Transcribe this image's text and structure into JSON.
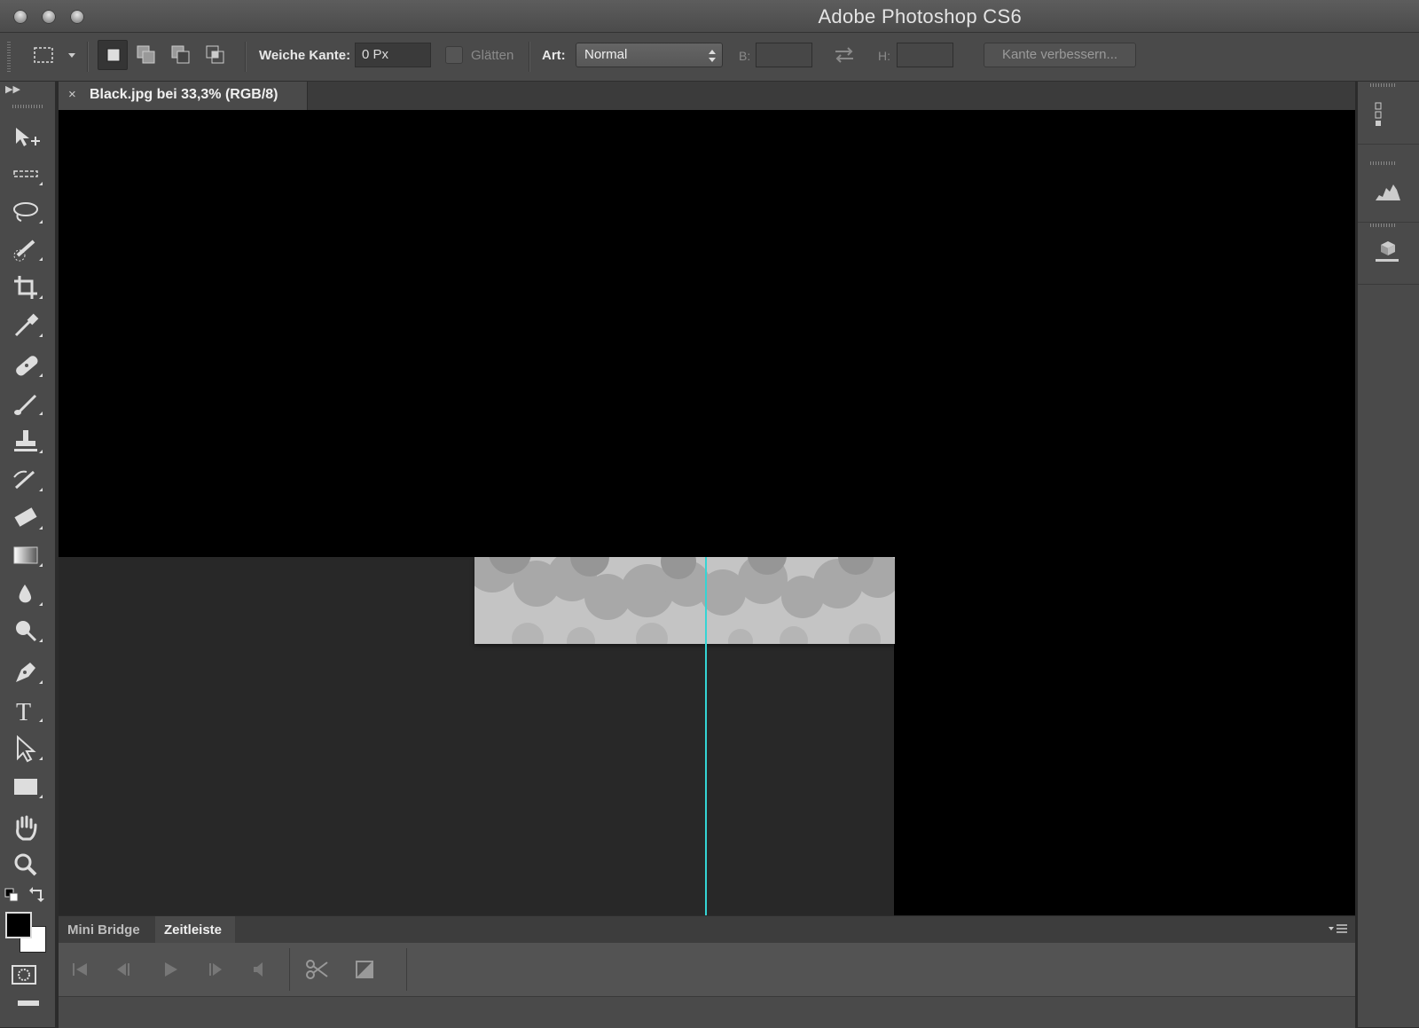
{
  "app": {
    "title": "Adobe Photoshop CS6"
  },
  "options_bar": {
    "feather_label": "Weiche Kante:",
    "feather_value": "0 Px",
    "antialias_label": "Glätten",
    "style_label": "Art:",
    "style_value": "Normal",
    "width_label": "B:",
    "height_label": "H:",
    "refine_edge_label": "Kante verbessern..."
  },
  "document": {
    "tab_title": "Black.jpg bei 33,3% (RGB/8)",
    "close_glyph": "×"
  },
  "timeline_panel": {
    "tabs": [
      {
        "label": "Mini Bridge",
        "active": false
      },
      {
        "label": "Zeitleiste",
        "active": true
      }
    ]
  },
  "tools": [
    "move-tool-icon",
    "marquee-tool-icon",
    "lasso-tool-icon",
    "quick-selection-tool-icon",
    "crop-tool-icon",
    "eyedropper-tool-icon",
    "healing-brush-tool-icon",
    "brush-tool-icon",
    "clone-stamp-tool-icon",
    "history-brush-tool-icon",
    "eraser-tool-icon",
    "gradient-tool-icon",
    "blur-tool-icon",
    "dodge-tool-icon",
    "pen-tool-icon",
    "type-tool-icon",
    "path-selection-tool-icon",
    "rectangle-tool-icon",
    "hand-tool-icon",
    "zoom-tool-icon"
  ],
  "colors": {
    "foreground": "#000000",
    "background": "#ffffff",
    "guide": "#35d4d4"
  }
}
